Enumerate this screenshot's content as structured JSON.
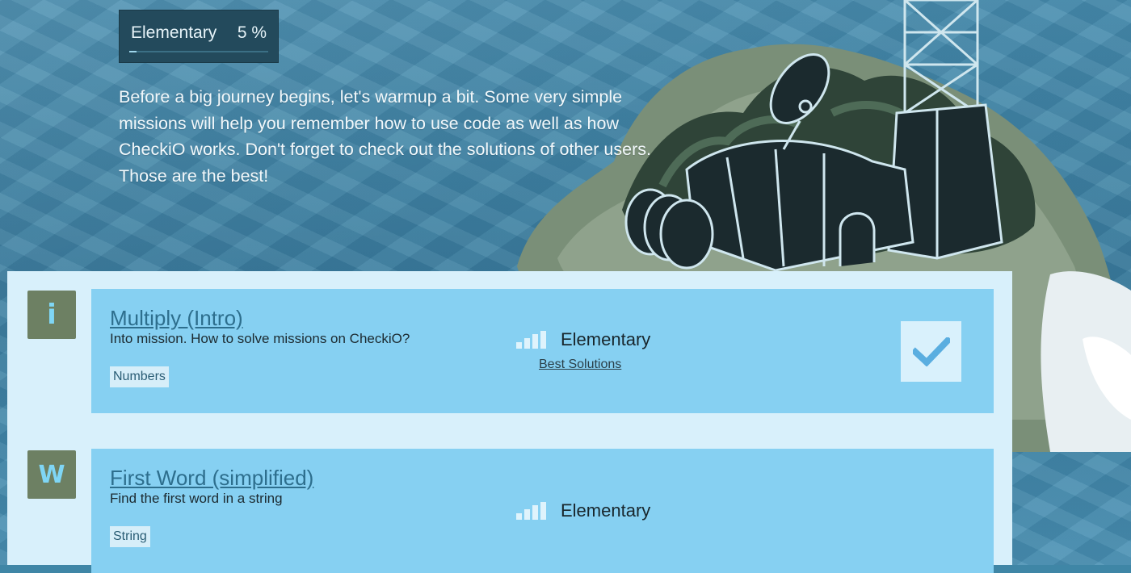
{
  "progress": {
    "label": "Elementary",
    "percent_text": "5 %",
    "fraction": 0.05
  },
  "intro": "Before a big journey begins, let's warmup a bit. Some very simple missions will help you remember how to use code as well as how CheckiO works. Don't forget to check out the solutions of other users. Those are the best!",
  "missions": [
    {
      "badge": "i",
      "title": "Multiply (Intro)",
      "description": "Into mission. How to solve missions on CheckiO?",
      "tag": "Numbers",
      "level": "Elementary",
      "best_solutions": "Best Solutions",
      "solved": true
    },
    {
      "badge": "W",
      "title": "First Word (simplified)",
      "description": "Find the first word in a string",
      "tag": "String",
      "level": "Elementary",
      "solved": false
    }
  ],
  "colors": {
    "ocean": "#3f86a6",
    "panel": "#d8f0fb",
    "card": "#86d0f2",
    "badge": "#6d8063",
    "link": "#2d6e8d",
    "progress_box": "#234a5c"
  }
}
